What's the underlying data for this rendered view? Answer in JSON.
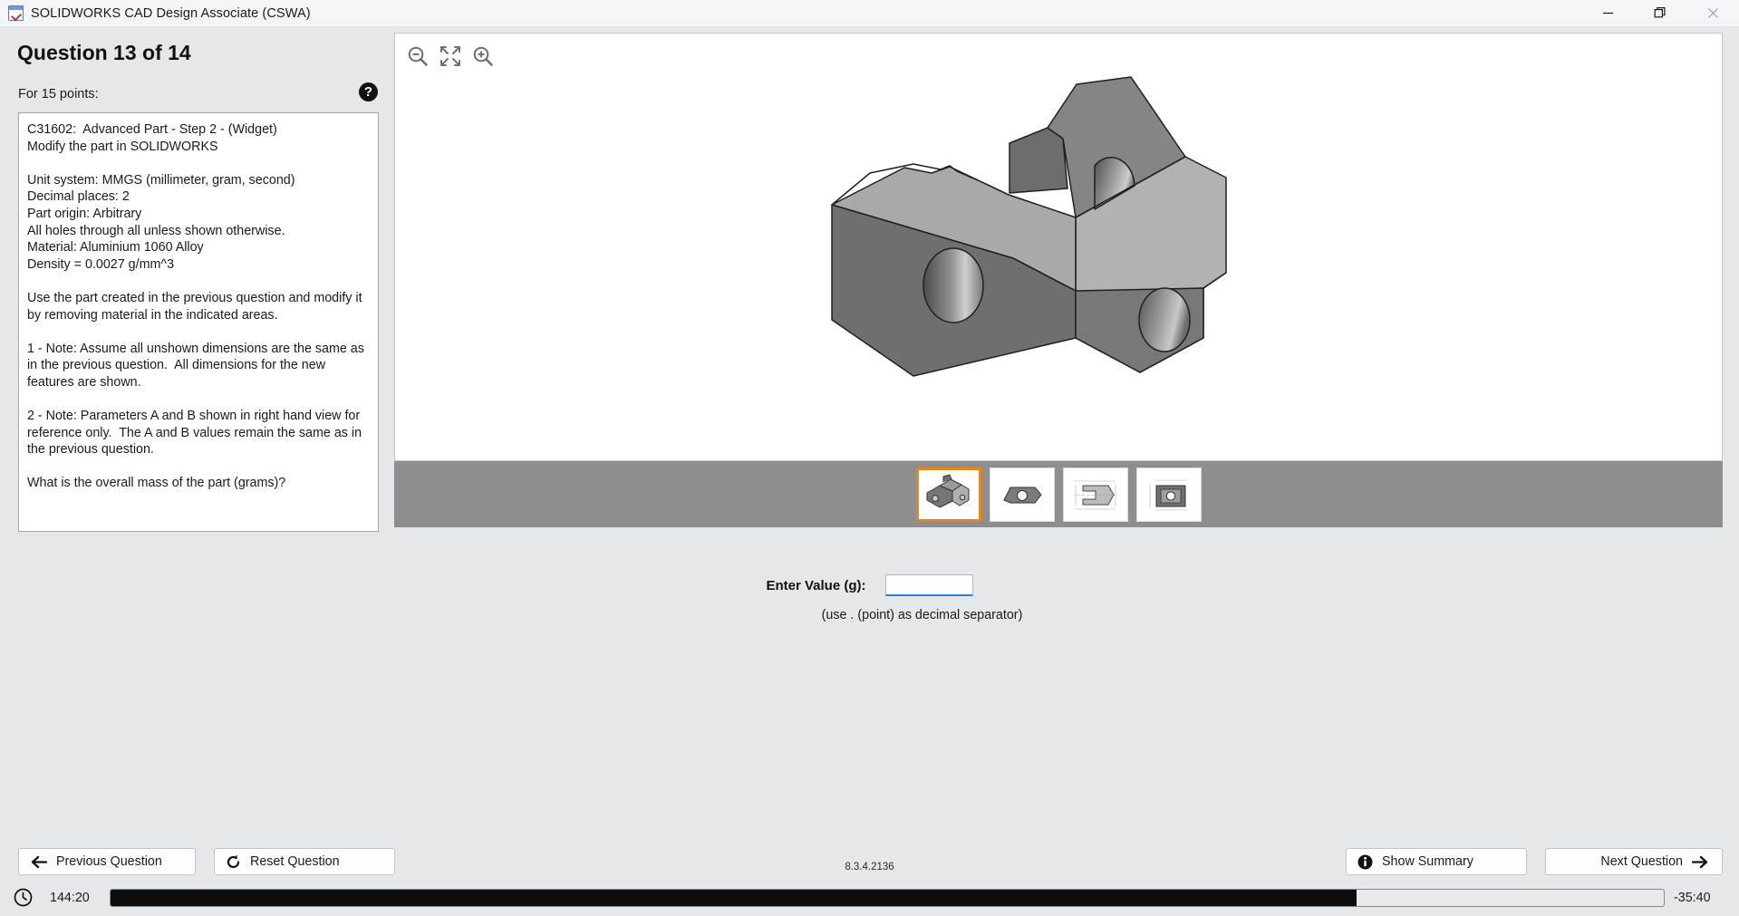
{
  "window": {
    "title": "SOLIDWORKS CAD Design Associate (CSWA)",
    "app_icon": "solidworks-test-icon",
    "minimize_label": "minimize-icon",
    "restore_label": "restore-icon",
    "close_label": "close-icon"
  },
  "question": {
    "heading": "Question 13 of 14",
    "points_label": "For 15 points:",
    "help_glyph": "?",
    "body": "C31602:  Advanced Part - Step 2 - (Widget)\nModify the part in SOLIDWORKS\n\nUnit system: MMGS (millimeter, gram, second)\nDecimal places: 2\nPart origin: Arbitrary\nAll holes through all unless shown otherwise.\nMaterial: Aluminium 1060 Alloy\nDensity = 0.0027 g/mm^3\n\nUse the part created in the previous question and modify it by removing material in the indicated areas.\n\n1 - Note: Assume all unshown dimensions are the same as in the previous question.  All dimensions for the new features are shown.\n\n2 - Note: Parameters A and B shown in right hand view for reference only.  The A and B values remain the same as in the previous question.\n\nWhat is the overall mass of the part (grams)?"
  },
  "viewer": {
    "toolbar": [
      {
        "name": "zoom-out-icon",
        "title": "Zoom Out"
      },
      {
        "name": "zoom-fit-icon",
        "title": "Zoom to Fit"
      },
      {
        "name": "zoom-in-icon",
        "title": "Zoom In"
      }
    ],
    "model_alt": "isometric-shaded-widget-part"
  },
  "thumbnails": [
    {
      "name": "thumbnail-isometric",
      "selected": true
    },
    {
      "name": "thumbnail-top-view",
      "selected": false
    },
    {
      "name": "thumbnail-side-dimensioned-view",
      "selected": false
    },
    {
      "name": "thumbnail-front-dimensioned-view",
      "selected": false
    }
  ],
  "answer": {
    "label": "Enter Value (g):",
    "value": "",
    "placeholder": "",
    "hint": "(use . (point) as decimal separator)"
  },
  "nav": {
    "previous_label": "Previous Question",
    "reset_label": "Reset Question",
    "summary_label": "Show Summary",
    "next_label": "Next Question"
  },
  "status": {
    "version": "8.3.4.2136",
    "elapsed": "144:20",
    "remaining": "-35:40",
    "progress_percent": 80.2
  },
  "colors": {
    "accent_selected": "#e8861e",
    "input_underline": "#2a7fd4",
    "titlebar_bg": "#f3f5f9",
    "page_bg": "#e5e8ea",
    "thumbstrip_bg": "#8e8e8e",
    "progress_fill": "#0d0d0d"
  }
}
